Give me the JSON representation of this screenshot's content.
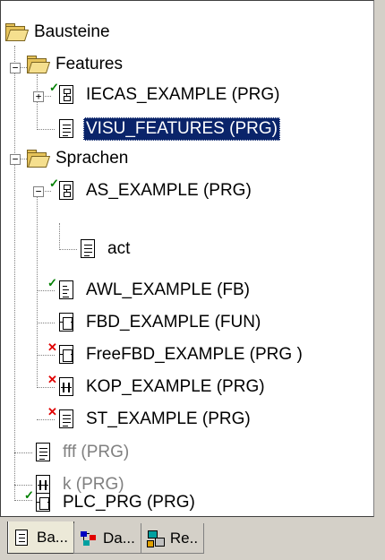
{
  "tree": {
    "root": {
      "label": "Bausteine",
      "icon": "folder-open-icon"
    },
    "features": {
      "label": "Features",
      "icon": "folder-open-icon"
    },
    "iecas": {
      "label": "IECAS_EXAMPLE (PRG)",
      "icon": "sfc-icon",
      "status": "checked"
    },
    "visu": {
      "label": "VISU_FEATURES (PRG)",
      "icon": "document-icon",
      "selected": true
    },
    "sprachen": {
      "label": "Sprachen",
      "icon": "folder-open-icon"
    },
    "as_example": {
      "label": "AS_EXAMPLE (PRG)",
      "icon": "sfc-icon",
      "status": "checked"
    },
    "act": {
      "label": "act",
      "icon": "document-icon"
    },
    "awl": {
      "label": "AWL_EXAMPLE (FB)",
      "icon": "il-document-icon",
      "status": "checked"
    },
    "fbd": {
      "label": "FBD_EXAMPLE (FUN)",
      "icon": "fbd-icon"
    },
    "freefbd": {
      "label": "FreeFBD_EXAMPLE (PRG  )",
      "icon": "fbd-icon",
      "status": "error"
    },
    "kop": {
      "label": "KOP_EXAMPLE (PRG)",
      "icon": "ladder-icon",
      "status": "error"
    },
    "st": {
      "label": "ST_EXAMPLE (PRG)",
      "icon": "document-icon",
      "status": "error"
    },
    "fff": {
      "label": "fff (PRG)",
      "icon": "document-icon",
      "disabled": true
    },
    "k": {
      "label": "k (PRG)",
      "icon": "ladder-icon",
      "disabled": true
    },
    "plc": {
      "label": "PLC_PRG (PRG)",
      "icon": "fbd-icon",
      "status": "checked"
    }
  },
  "tabs": [
    {
      "label": "Ba...",
      "icon": "document-icon",
      "active": true
    },
    {
      "label": "Da...",
      "icon": "data-types-icon",
      "active": false
    },
    {
      "label": "Re..",
      "icon": "resources-icon",
      "active": false
    }
  ],
  "colors": {
    "selection": "#0a246a",
    "ok_mark": "#008000",
    "error_mark": "#e00000",
    "folder": "#e6c35a"
  }
}
